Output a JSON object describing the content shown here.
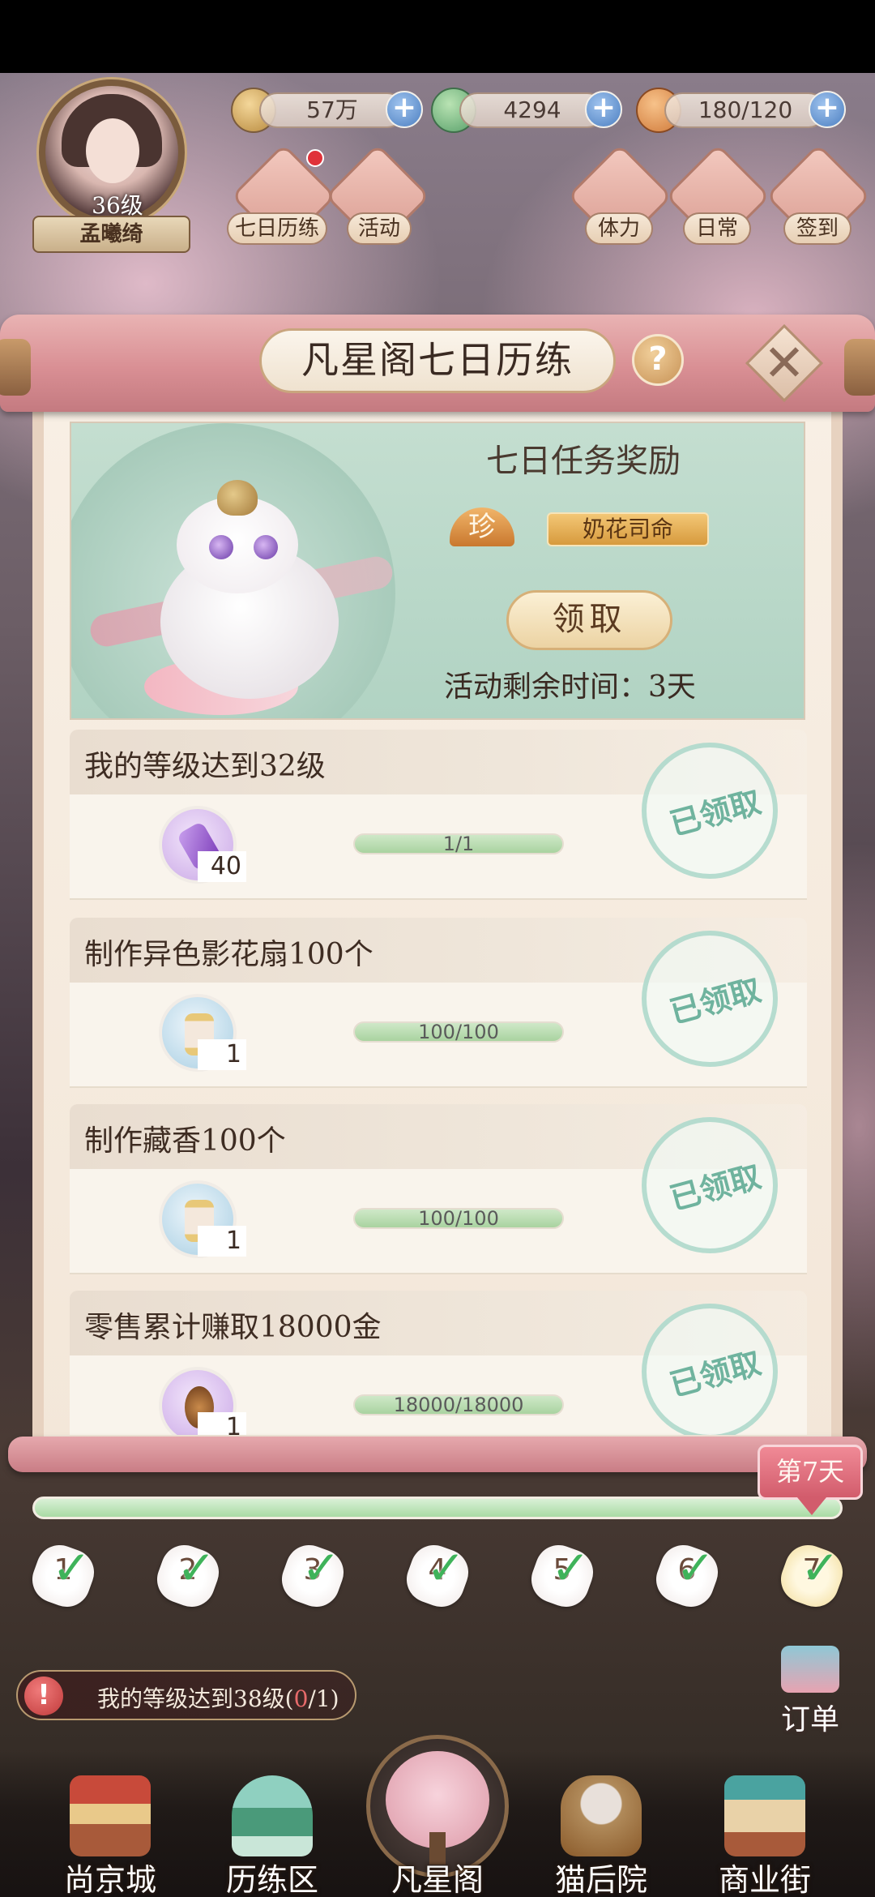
{
  "hud": {
    "level": "36级",
    "player_name": "孟曦绮",
    "resources": [
      {
        "icon": "coin-icon",
        "value": "57万"
      },
      {
        "icon": "bird-currency-icon",
        "value": "4294"
      },
      {
        "icon": "bun-stamina-icon",
        "value": "180/120"
      }
    ],
    "shortcuts": [
      "七日历练",
      "活动",
      "体力",
      "日常",
      "签到"
    ]
  },
  "panel": {
    "title": "凡星阁七日历练",
    "help": "?",
    "close": "✕",
    "reward": {
      "title": "七日任务奖励",
      "rarity": "珍",
      "name": "奶花司命",
      "claim_label": "领取",
      "remaining": "活动剩余时间：3天"
    },
    "tasks": [
      {
        "title": "我的等级达到32级",
        "item_count": "40",
        "progress": "1/1",
        "status": "已领取"
      },
      {
        "title": "制作异色影花扇100个",
        "item_count": "1",
        "progress": "100/100",
        "status": "已领取"
      },
      {
        "title": "制作藏香100个",
        "item_count": "1",
        "progress": "100/100",
        "status": "已领取"
      },
      {
        "title": "零售累计赚取18000金",
        "item_count": "1",
        "progress": "18000/18000",
        "status": "已领取"
      }
    ]
  },
  "days": {
    "current_label": "第7天",
    "items": [
      "1",
      "2",
      "3",
      "4",
      "5",
      "6",
      "7"
    ],
    "check": "✓"
  },
  "side": {
    "order_label": "订单"
  },
  "notice": {
    "warn": "!",
    "text": "我的等级达到38级(",
    "progress_current": "0",
    "progress_rest": "/1)"
  },
  "nav": {
    "items": [
      "尚京城",
      "历练区",
      "凡星阁",
      "猫后院",
      "商业街"
    ]
  },
  "colors": {
    "accent_pink": "#d98f94",
    "mint": "#b1d3c3",
    "progress_green": "#a9d3a0",
    "stamp_teal": "#6fb39e"
  }
}
